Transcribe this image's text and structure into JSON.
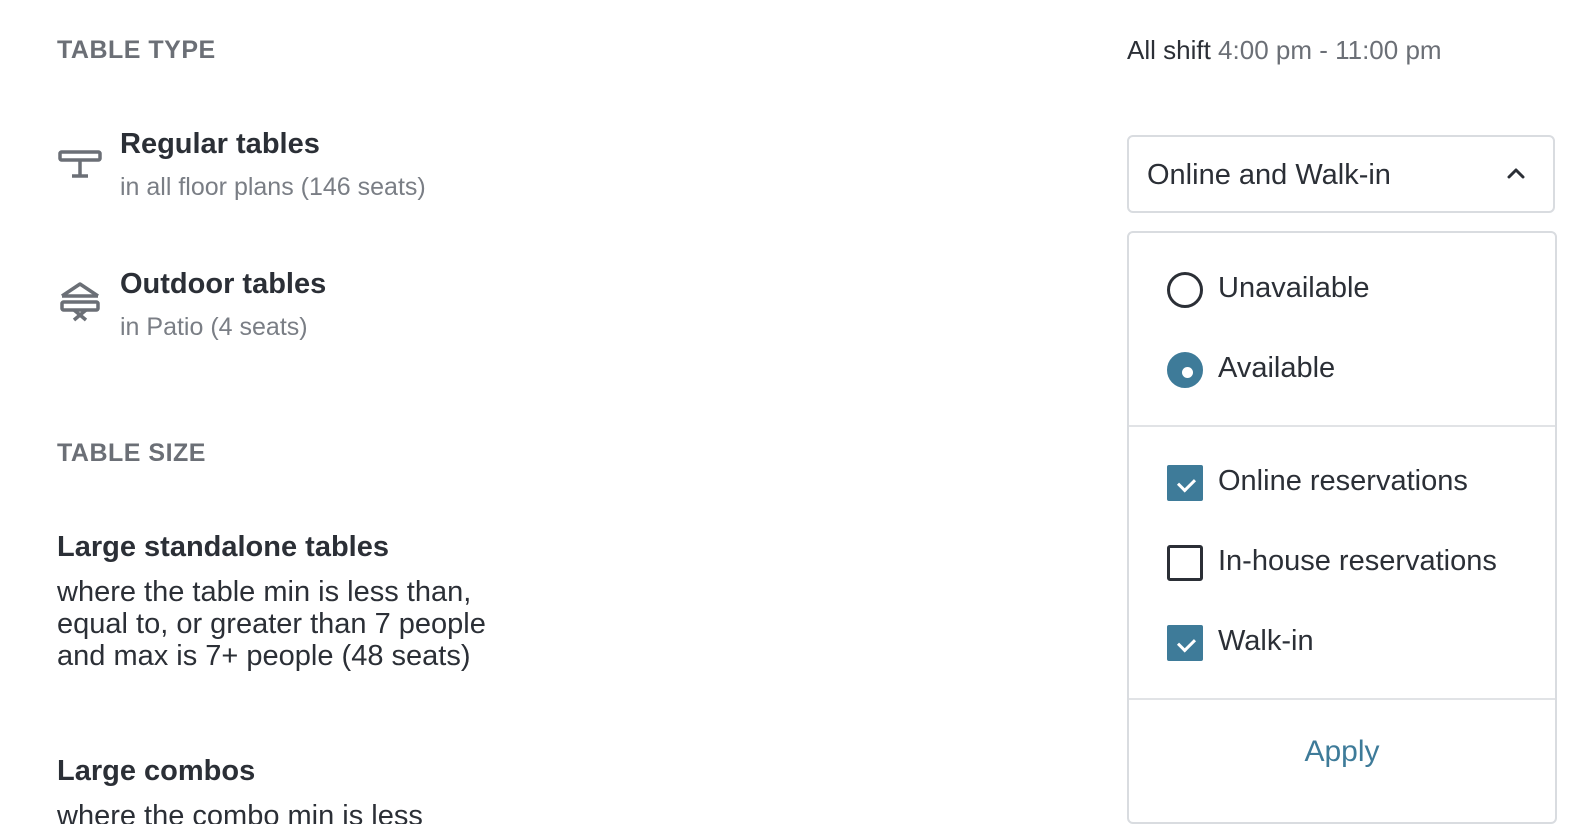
{
  "table_type": {
    "heading": "TABLE TYPE",
    "items": [
      {
        "icon": "regular-table-icon",
        "title": "Regular tables",
        "subtitle": "in all floor plans (146 seats)"
      },
      {
        "icon": "outdoor-table-icon",
        "title": "Outdoor tables",
        "subtitle": "in Patio (4 seats)"
      }
    ]
  },
  "table_size": {
    "heading": "TABLE SIZE",
    "items": [
      {
        "title": "Large standalone tables",
        "description": "where the table min is less than, equal to, or greater than 7 people and max is 7+ people (48 seats)"
      },
      {
        "title": "Large combos",
        "description": "where the combo min is less"
      }
    ]
  },
  "shift": {
    "label": "All shift",
    "time": "4:00 pm - 11:00 pm"
  },
  "availability_select": {
    "value": "Online and Walk-in",
    "icon": "chevron-up-icon",
    "open": true
  },
  "availability_menu": {
    "radios": [
      {
        "label": "Unavailable",
        "selected": false
      },
      {
        "label": "Available",
        "selected": true
      }
    ],
    "checkboxes": [
      {
        "label": "Online reservations",
        "checked": true
      },
      {
        "label": "In-house reservations",
        "checked": false
      },
      {
        "label": "Walk-in",
        "checked": true
      }
    ],
    "apply_label": "Apply"
  },
  "colors": {
    "accent": "#3e7b99",
    "heading_gray": "#6b6f76",
    "text": "#2b2f36",
    "border": "#d9dce0"
  }
}
